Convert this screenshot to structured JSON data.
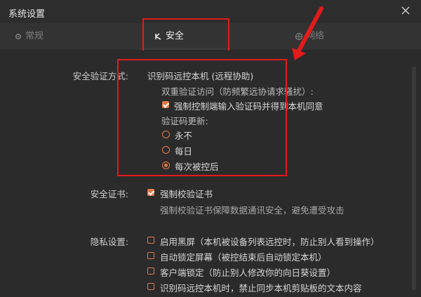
{
  "window": {
    "title": "系统设置",
    "close_icon": "close-icon"
  },
  "tabs": [
    {
      "label": "常规",
      "icon": "gear-icon"
    },
    {
      "label": "安全",
      "icon": "security-icon"
    },
    {
      "label": "网络",
      "icon": "globe-icon"
    }
  ],
  "auth": {
    "label": "安全验证方式:",
    "method": "识别码远控本机 (远程协助)",
    "dual_verify": "双重验证访问（防频繁远协请求骚扰）:",
    "force_confirm": "强制控制端输入验证码并得到本机同意",
    "code_update_label": "验证码更新:",
    "options": [
      "永不",
      "每日",
      "每次被控后"
    ],
    "selected": "每次被控后"
  },
  "cert": {
    "label": "安全证书:",
    "check_label": "强制校验证书",
    "desc": "强制校验证书保障数据通讯安全，避免遭受攻击"
  },
  "privacy": {
    "label": "隐私设置:",
    "items": [
      "启用黑屏（本机被设备列表远控时，防止别人看到操作）",
      "自动锁定屏幕（被控结束后自动锁定本机）",
      "客户端锁定（防止别人修改你的向日葵设置）",
      "识别码远控本机时，禁止同步本机剪贴板的文本内容"
    ]
  },
  "colors": {
    "accent": "#e07a4a",
    "annotation": "#e21b1b"
  }
}
